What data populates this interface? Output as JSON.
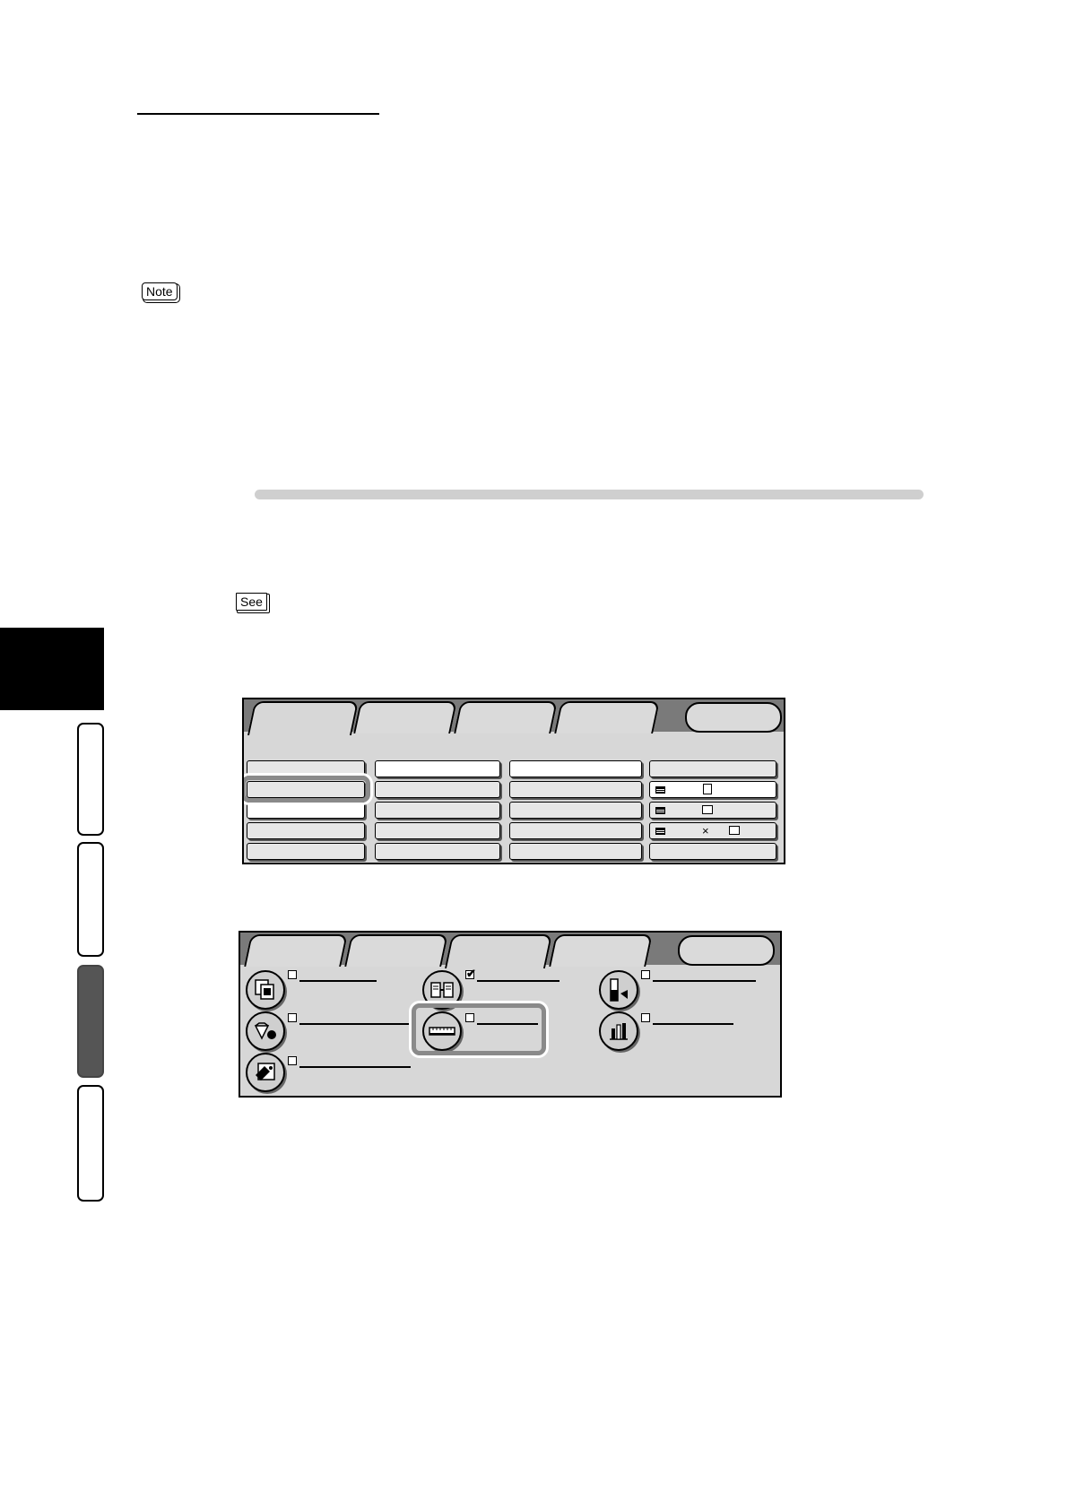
{
  "badges": {
    "note": "Note",
    "see": "See"
  },
  "basic_panel": {
    "tabs": [
      "",
      "",
      "",
      ""
    ],
    "pill": ""
  },
  "image_quality_panel": {
    "tabs": [
      "",
      "",
      "",
      ""
    ],
    "pill": "",
    "features": [
      {
        "icon": "copy-preview-icon",
        "checked": false
      },
      {
        "icon": "split-pages-icon",
        "checked": true
      },
      {
        "icon": "color-balance-icon",
        "checked": false
      },
      {
        "icon": "diamond-sharpness-icon",
        "checked": false
      },
      {
        "icon": "ruler-adjust-icon",
        "checked": false
      },
      {
        "icon": "bar-graph-icon",
        "checked": false
      },
      {
        "icon": "image-edit-icon",
        "checked": false
      }
    ],
    "multiply_symbol": "×"
  }
}
